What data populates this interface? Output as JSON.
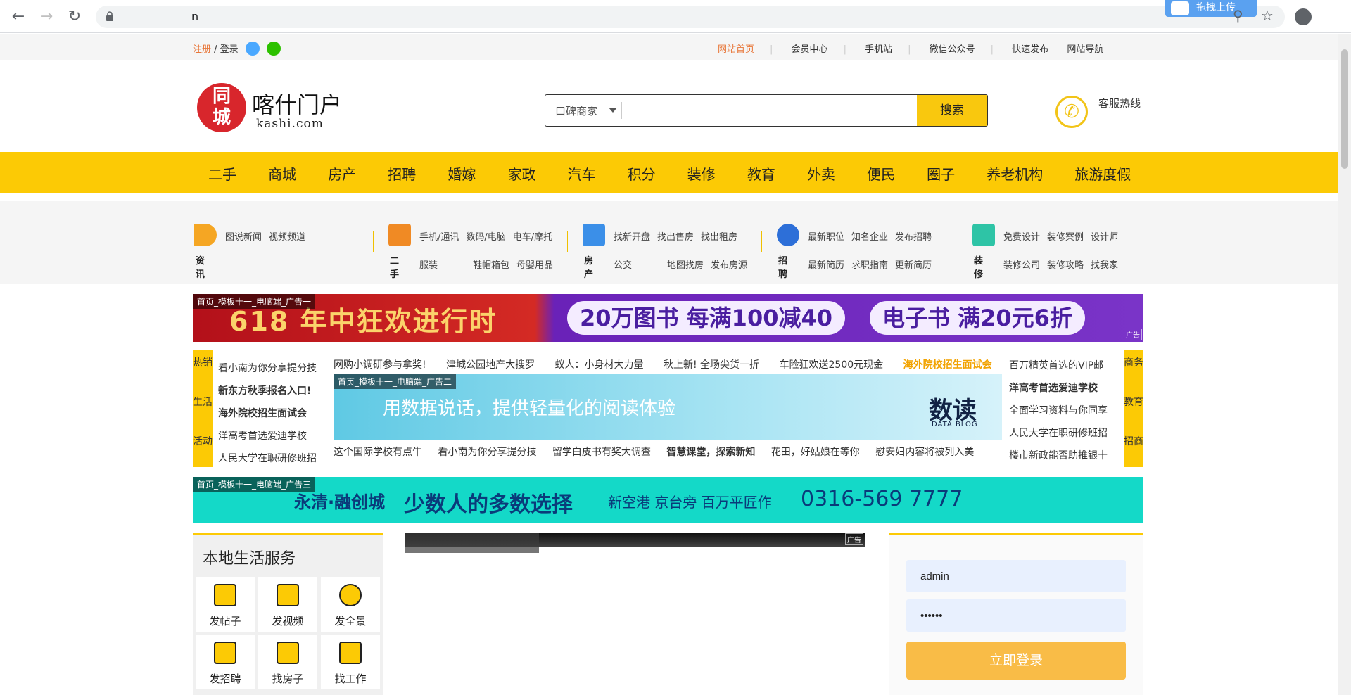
{
  "browser": {
    "url": "n",
    "upload_label": "拖拽上传"
  },
  "topbar": {
    "register": "注册",
    "slash": " / ",
    "login": "登录",
    "links": [
      "网站首页",
      "会员中心",
      "手机站",
      "微信公众号",
      "快速发布",
      "网站导航"
    ]
  },
  "header": {
    "logo_badge_line1": "同",
    "logo_badge_line2": "城",
    "logo_title": "喀什门户",
    "logo_sub": "kashi.com",
    "search_select": "口碑商家",
    "search_placeholder": "",
    "search_button": "搜索",
    "hotline": "客服热线"
  },
  "mainnav": [
    "二手",
    "商城",
    "房产",
    "招聘",
    "婚嫁",
    "家政",
    "汽车",
    "积分",
    "装修",
    "教育",
    "外卖",
    "便民",
    "圈子",
    "养老机构",
    "旅游度假"
  ],
  "categories": [
    {
      "name": "资讯",
      "links": [
        "图说新闻",
        "视频频道"
      ],
      "color": "#f5a623"
    },
    {
      "name": "二手",
      "links": [
        "手机/通讯",
        "数码/电脑",
        "电车/摩托",
        "服装",
        "鞋帽箱包",
        "母婴用品"
      ],
      "color": "#f08a24"
    },
    {
      "name": "房产",
      "links": [
        "找新开盘",
        "找出售房",
        "找出租房",
        "公交",
        "地图找房",
        "发布房源"
      ],
      "color": "#3b8fe8"
    },
    {
      "name": "招聘",
      "links": [
        "最新职位",
        "知名企业",
        "发布招聘",
        "最新简历",
        "求职指南",
        "更新简历"
      ],
      "color": "#2d6fd8"
    },
    {
      "name": "装修",
      "links": [
        "免费设计",
        "装修案例",
        "设计师",
        "装修公司",
        "装修攻略",
        "找我家"
      ],
      "color": "#2ec4a6"
    }
  ],
  "banner1": {
    "tag": "首页_模板十一_电脑端_广告一",
    "left": "618 年中狂欢进行时",
    "pill1": "20万图书 每满100减40",
    "pill2": "电子书 满20元6折",
    "corner": "广告"
  },
  "news": {
    "left_tabs": [
      "热销",
      "生活",
      "活动"
    ],
    "right_tabs": [
      "商务",
      "教育",
      "招商"
    ],
    "left_col": [
      "看小南为你分享提分技",
      "新东方秋季报名入口!",
      "海外院校招生面试会",
      "洋高考首选爱迪学校",
      "人民大学在职研修班招"
    ],
    "top_row": [
      "网购小调研参与拿奖!",
      "津城公园地产大搜罗",
      "蚁人：小身材大力量",
      "秋上新! 全场尖货一折",
      "车险狂欢送2500元现金",
      "海外院校招生面试会"
    ],
    "bottom_row": [
      "这个国际学校有点牛",
      "看小南为你分享提分技",
      "留学白皮书有奖大调查",
      "智慧课堂，探索新知",
      "花田，好姑娘在等你",
      "慰安妇内容将被列入美"
    ],
    "right_col": [
      "百万精英首选的VIP邮",
      "洋高考首选爱迪学校",
      "全面学习资料与你同享",
      "人民大学在职研修班招",
      "楼市新政能否助推银十"
    ]
  },
  "banner2": {
    "tag": "首页_模板十一_电脑端_广告二",
    "text": "用数据说话，提供轻量化的阅读体验",
    "brand": "数读",
    "brand_sub": "DATA BLOG"
  },
  "banner3": {
    "tag": "首页_模板十一_电脑端_广告三",
    "brand": "永清·融创城",
    "slogan": "少数人的多数选择",
    "mid": "新空港  京台旁  百万平匠作",
    "phone": "0316-569 7777"
  },
  "local": {
    "title": "本地生活服务",
    "tiles": [
      "发帖子",
      "发视频",
      "发全景",
      "发招聘",
      "找房子",
      "找工作"
    ]
  },
  "video": {
    "corner": "广告"
  },
  "login": {
    "username": "admin",
    "password": "••••••",
    "submit": "立即登录"
  }
}
